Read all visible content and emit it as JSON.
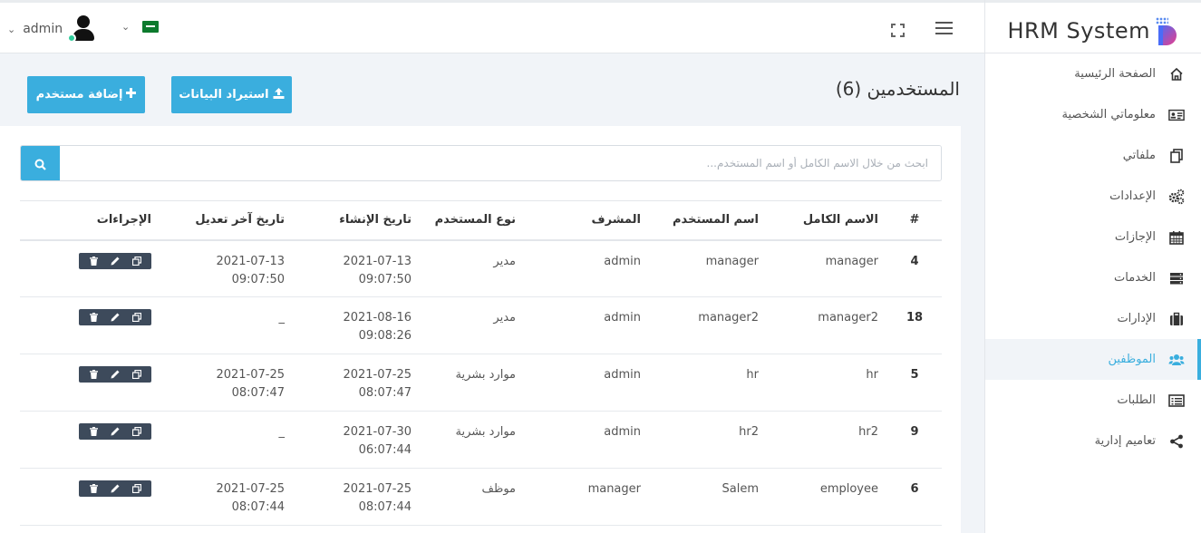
{
  "app": {
    "title": "HRM System"
  },
  "header": {
    "username": "admin",
    "user_chevron": "⌄",
    "lang_chevron": "⌄"
  },
  "sidebar": {
    "items": [
      {
        "label": "الصفحة الرئيسية",
        "icon": "home-icon"
      },
      {
        "label": "معلوماتي الشخصية",
        "icon": "id-card-icon"
      },
      {
        "label": "ملفاتي",
        "icon": "files-icon"
      },
      {
        "label": "الإعدادات",
        "icon": "gears-icon"
      },
      {
        "label": "الإجازات",
        "icon": "calendar-icon"
      },
      {
        "label": "الخدمات",
        "icon": "server-icon"
      },
      {
        "label": "الإدارات",
        "icon": "briefcase-icon"
      },
      {
        "label": "الموظفين",
        "icon": "users-icon",
        "active": true
      },
      {
        "label": "الطلبات",
        "icon": "list-icon"
      },
      {
        "label": "تعاميم إدارية",
        "icon": "share-icon"
      }
    ]
  },
  "page": {
    "title": "المستخدمين (6)",
    "import_label": "استيراد البيانات",
    "add_label": "إضافة مستخدم"
  },
  "search": {
    "placeholder": "ابحث من خلال الاسم الكامل أو اسم المستخدم..."
  },
  "table": {
    "headers": [
      "#",
      "الاسم الكامل",
      "اسم المستخدم",
      "المشرف",
      "نوع المستخدم",
      "تاريخ الإنشاء",
      "تاريخ آخر تعديل",
      "الإجراءات"
    ],
    "rows": [
      {
        "id": "4",
        "full_name": "manager",
        "username": "manager",
        "supervisor": "admin",
        "type": "مدير",
        "created_date": "2021-07-13",
        "created_time": "09:07:50",
        "updated_date": "2021-07-13",
        "updated_time": "09:07:50"
      },
      {
        "id": "18",
        "full_name": "manager2",
        "username": "manager2",
        "supervisor": "admin",
        "type": "مدير",
        "created_date": "2021-08-16",
        "created_time": "09:08:26",
        "updated_date": "_",
        "updated_time": ""
      },
      {
        "id": "5",
        "full_name": "hr",
        "username": "hr",
        "supervisor": "admin",
        "type": "موارد بشرية",
        "created_date": "2021-07-25",
        "created_time": "08:07:47",
        "updated_date": "2021-07-25",
        "updated_time": "08:07:47"
      },
      {
        "id": "9",
        "full_name": "hr2",
        "username": "hr2",
        "supervisor": "admin",
        "type": "موارد بشرية",
        "created_date": "2021-07-30",
        "created_time": "06:07:44",
        "updated_date": "_",
        "updated_time": ""
      },
      {
        "id": "6",
        "full_name": "employee",
        "username": "Salem",
        "supervisor": "manager",
        "type": "موظف",
        "created_date": "2021-07-25",
        "created_time": "08:07:44",
        "updated_date": "2021-07-25",
        "updated_time": "08:07:44"
      }
    ]
  },
  "colors": {
    "accent": "#3aaede",
    "actions_bg": "#3d4a5b",
    "online": "#2ecc9a"
  }
}
